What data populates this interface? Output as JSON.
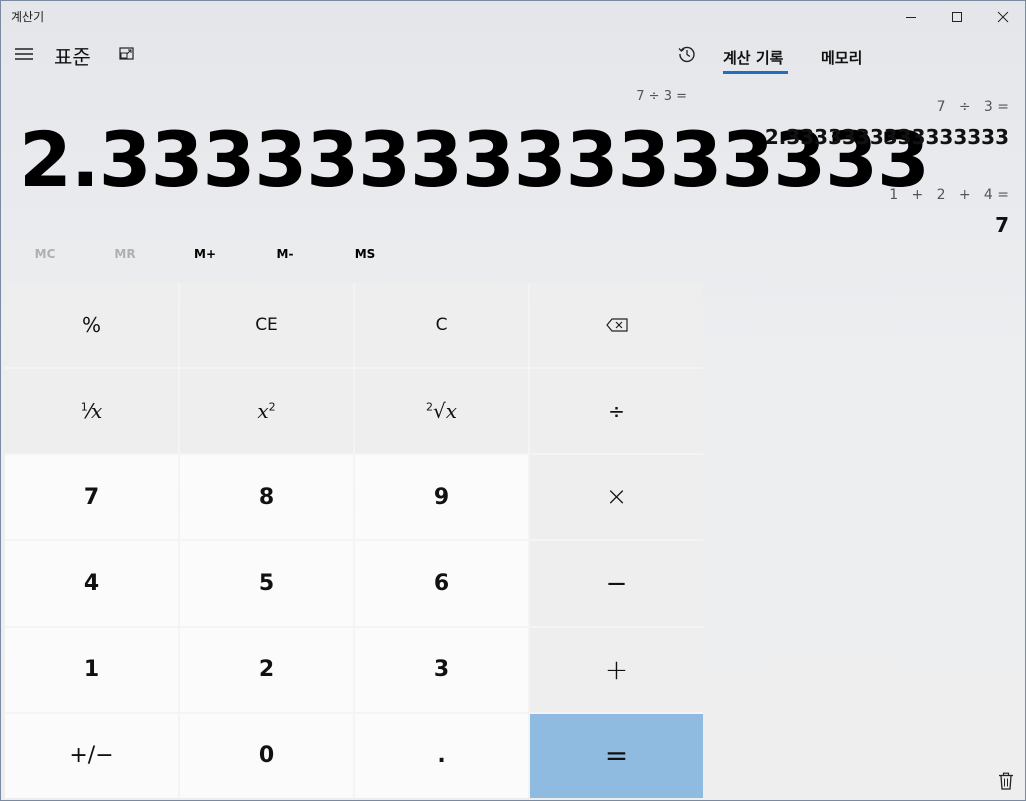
{
  "window": {
    "title": "계산기",
    "controls": [
      "minimize-icon",
      "maximize-icon",
      "close-icon"
    ]
  },
  "header": {
    "menu_icon": "hamburger-icon",
    "mode": "표준",
    "keep_on_top_icon": "keep-on-top-icon",
    "history_icon": "history-icon"
  },
  "display": {
    "expression": "7 ÷ 3 =",
    "result": "2.3333333333333333"
  },
  "memory": [
    {
      "label": "MC",
      "enabled": false
    },
    {
      "label": "MR",
      "enabled": false
    },
    {
      "label": "M+",
      "enabled": true
    },
    {
      "label": "M-",
      "enabled": true
    },
    {
      "label": "MS",
      "enabled": true
    }
  ],
  "keys": {
    "percent": "%",
    "ce": "CE",
    "c": "C",
    "backspace_icon": "backspace-icon",
    "reciprocal": "x",
    "square": "x",
    "square_sup": "2",
    "sqrt": "x",
    "sqrt_index": "2",
    "divide": "÷",
    "seven": "7",
    "eight": "8",
    "nine": "9",
    "multiply": "×",
    "four": "4",
    "five": "5",
    "six": "6",
    "minus": "−",
    "one": "1",
    "two": "2",
    "three": "3",
    "plus": "+",
    "negate": "+/−",
    "zero": "0",
    "decimal": ".",
    "equals": "="
  },
  "panel": {
    "tabs": [
      "계산 기록",
      "메모리"
    ],
    "active_tab": "계산 기록",
    "history": [
      {
        "expression": "7   ÷   3 =",
        "result": "2.3333333333333333"
      },
      {
        "expression": "1   +   2   +   4 =",
        "result": "7"
      }
    ],
    "delete_icon": "trash-icon"
  },
  "colors": {
    "accent": "#1f6fc0",
    "equals_key": "#8fbbe1"
  }
}
